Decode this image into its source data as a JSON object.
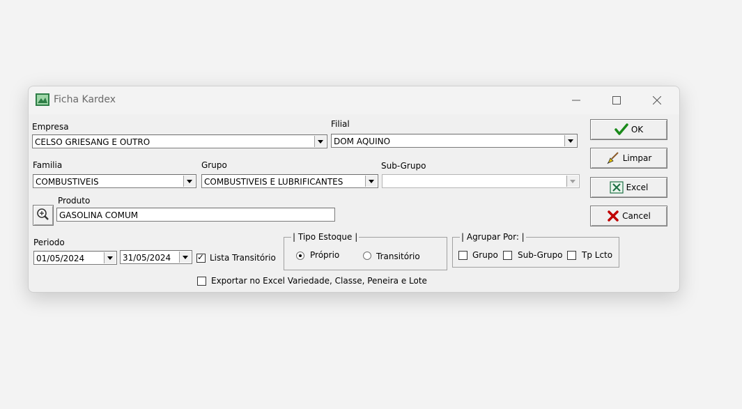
{
  "window": {
    "title": "Ficha Kardex",
    "controls": {
      "minimize": "—",
      "maximize": "☐",
      "close": "✕"
    }
  },
  "empresa": {
    "label": "Empresa",
    "value": "CELSO GRIESANG E OUTRO"
  },
  "filial": {
    "label": "Filial",
    "value": "DOM AQUINO"
  },
  "familia": {
    "label": "Familia",
    "value": "COMBUSTIVEIS"
  },
  "grupo": {
    "label": "Grupo",
    "value": "COMBUSTIVEIS E LUBRIFICANTES"
  },
  "subgrupo": {
    "label": "Sub-Grupo",
    "value": ""
  },
  "produto": {
    "label": "Produto",
    "value": "GASOLINA COMUM"
  },
  "periodo": {
    "label": "Periodo",
    "start": "01/05/2024",
    "end": "31/05/2024"
  },
  "lista_transitorio": {
    "label": "Lista Transitório",
    "checked": true
  },
  "tipo_estoque": {
    "label": "Tipo Estoque",
    "options": [
      {
        "label": "Próprio",
        "selected": true
      },
      {
        "label": "Transitório",
        "selected": false
      }
    ]
  },
  "agrupar_por": {
    "label": "Agrupar Por:",
    "options": [
      {
        "label": "Grupo",
        "checked": false
      },
      {
        "label": "Sub-Grupo",
        "checked": false
      },
      {
        "label": "Tp Lcto",
        "checked": false
      }
    ]
  },
  "exportar": {
    "label": "Exportar no Excel Variedade, Classe, Peneira e Lote",
    "checked": false
  },
  "buttons": {
    "ok": "OK",
    "limpar": "Limpar",
    "excel": "Excel",
    "cancel": "Cancel"
  },
  "colors": {
    "ok_check": "#1a8a1a",
    "cancel_x": "#c00000",
    "excel_green": "#1e7145"
  }
}
